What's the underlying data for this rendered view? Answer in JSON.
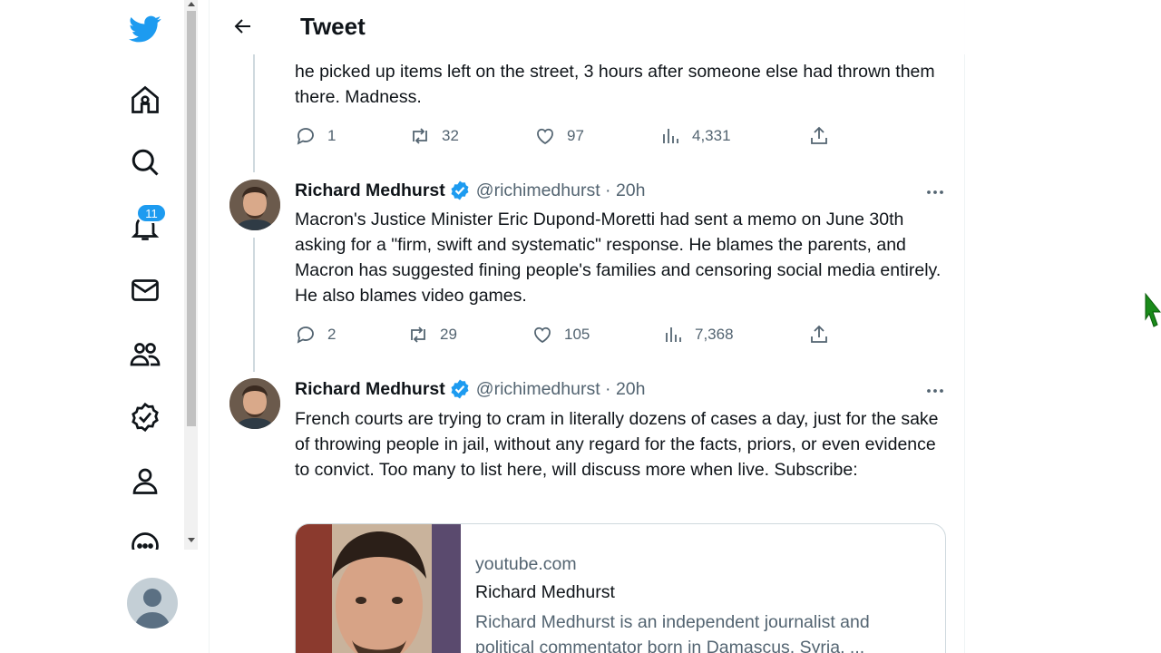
{
  "nav": {
    "notifications_badge": "11",
    "icons": [
      "twitter-logo-icon",
      "home-icon",
      "explore-icon",
      "notifications-icon",
      "messages-icon",
      "communities-icon",
      "verified-icon",
      "profile-icon",
      "more-icon"
    ]
  },
  "header": {
    "title": "Tweet"
  },
  "colors": {
    "accent": "#1d9bf0",
    "text": "#0f1419",
    "secondary": "#536471"
  },
  "tweets": [
    {
      "text": "he picked up items left on the street, 3 hours after someone else had thrown them there. Madness.",
      "replies": "1",
      "retweets": "32",
      "likes": "97",
      "views": "4,331"
    },
    {
      "author": "Richard Medhurst",
      "handle_time": "@richimedhurst · 20h",
      "text": "Macron's Justice Minister Eric Dupond-Moretti had sent a memo on June 30th asking for a \"firm, swift and systematic\" response. He blames the parents, and Macron has suggested fining people's families and censoring social media entirely. He also blames video games.",
      "replies": "2",
      "retweets": "29",
      "likes": "105",
      "views": "7,368"
    },
    {
      "author": "Richard Medhurst",
      "handle_time": "@richimedhurst · 20h",
      "text": "French courts are trying to cram in literally dozens of cases a day, just for the sake of throwing people in jail, without any regard for the facts, priors, or even evidence to convict. Too many to list here, will discuss more when live. Subscribe:",
      "card": {
        "domain": "youtube.com",
        "title": "Richard Medhurst",
        "description": "Richard Medhurst is an independent journalist and political commentator born in Damascus, Syria. ..."
      }
    }
  ]
}
